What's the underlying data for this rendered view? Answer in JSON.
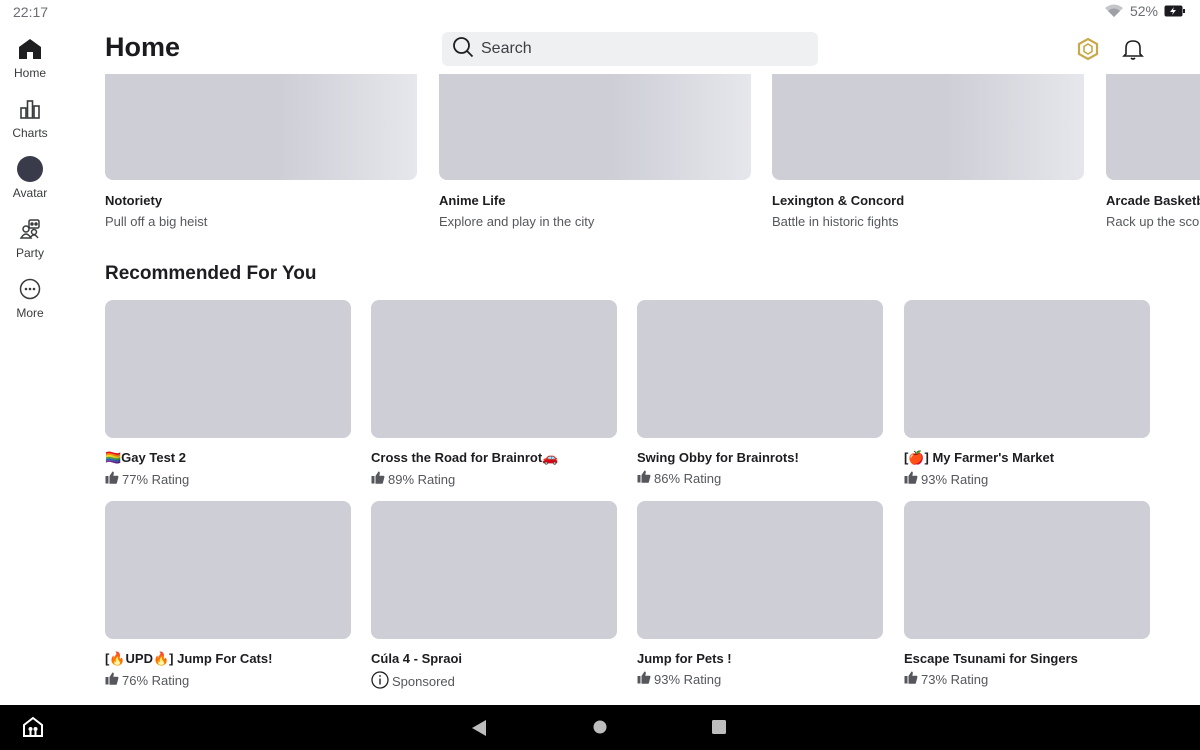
{
  "status": {
    "time": "22:17",
    "battery": "52%"
  },
  "sidebar": {
    "items": [
      {
        "label": "Home",
        "icon": "home-icon"
      },
      {
        "label": "Charts",
        "icon": "charts-icon"
      },
      {
        "label": "Avatar",
        "icon": "avatar-icon"
      },
      {
        "label": "Party",
        "icon": "party-icon"
      },
      {
        "label": "More",
        "icon": "more-icon"
      }
    ]
  },
  "header": {
    "title": "Home",
    "search_placeholder": "Search"
  },
  "featured": [
    {
      "title": "Notoriety",
      "subtitle": "Pull off a big heist"
    },
    {
      "title": "Anime Life",
      "subtitle": "Explore and play in the city"
    },
    {
      "title": "Lexington & Concord",
      "subtitle": "Battle in historic fights"
    },
    {
      "title": "Arcade Basketball",
      "subtitle": "Rack up the score"
    }
  ],
  "recommended": {
    "title": "Recommended For You",
    "games": [
      {
        "title": "🏳️‍🌈Gay Test 2",
        "meta": "77% Rating",
        "meta_icon": "thumbs-up-icon"
      },
      {
        "title": "Cross the Road for Brainrot🚗",
        "meta": "89% Rating",
        "meta_icon": "thumbs-up-icon"
      },
      {
        "title": "Swing Obby for Brainrots!",
        "meta": "86% Rating",
        "meta_icon": "thumbs-up-icon"
      },
      {
        "title": "[🍎] My Farmer's Market",
        "meta": "93% Rating",
        "meta_icon": "thumbs-up-icon"
      },
      {
        "title": "[🔥UPD🔥] Jump For Cats!",
        "meta": "76% Rating",
        "meta_icon": "thumbs-up-icon"
      },
      {
        "title": "Cúla 4 - Spraoi",
        "meta": "Sponsored",
        "meta_icon": "info-icon"
      },
      {
        "title": "Jump for Pets !",
        "meta": "93% Rating",
        "meta_icon": "thumbs-up-icon"
      },
      {
        "title": "Escape Tsunami for Singers",
        "meta": "73% Rating",
        "meta_icon": "thumbs-up-icon"
      }
    ]
  },
  "colors": {
    "placeholder": "#cdced6",
    "nav_bar": "#000000",
    "search_bg": "#eef0f2",
    "robux_accent": "#c9a94a"
  }
}
